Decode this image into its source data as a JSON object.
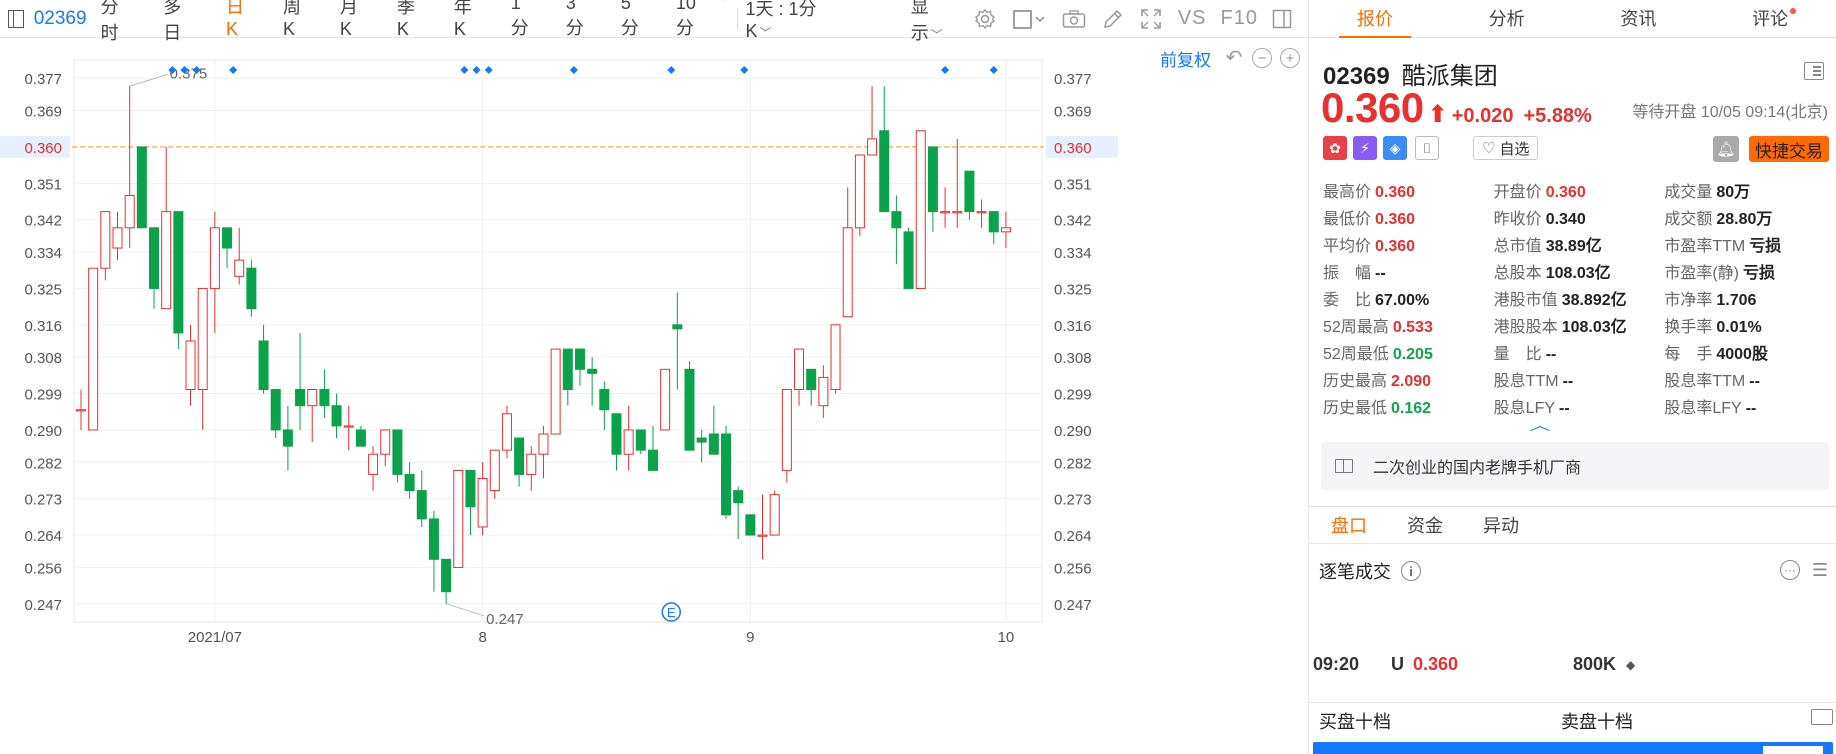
{
  "toolbar": {
    "code": "02369",
    "periods": [
      "分时",
      "多日",
      "日K",
      "周K",
      "月K",
      "季K",
      "年K",
      "1分",
      "3分",
      "5分",
      "10分"
    ],
    "active_period": "日K",
    "kline_mode": "1天 : 1分K",
    "display_label": "显示",
    "vs_label": "VS",
    "f10_label": "F10",
    "icons": [
      "sidebar-toggle-icon",
      "settings-icon",
      "rectangle-draw-icon",
      "camera-icon",
      "pen-icon",
      "fullscreen-icon",
      "panel-icon"
    ]
  },
  "chart": {
    "adjust_label": "前复权",
    "controls": [
      "undo-icon",
      "zoom-out-icon",
      "zoom-in-icon"
    ]
  },
  "chart_data": {
    "type": "candlestick",
    "y_ticks": [
      "0.377",
      "0.369",
      "0.360",
      "0.351",
      "0.342",
      "0.334",
      "0.325",
      "0.316",
      "0.308",
      "0.299",
      "0.290",
      "0.282",
      "0.273",
      "0.264",
      "0.256",
      "0.247"
    ],
    "ylim": [
      0.2425,
      0.3815
    ],
    "x_labels": [
      "2021/07",
      "8",
      "9",
      "10"
    ],
    "x_label_index": [
      11,
      33,
      55,
      76
    ],
    "current_price": "0.360",
    "max_marker": "0.375",
    "min_marker": "0.247",
    "event_marker": "E",
    "event_index": 48.5,
    "diamond_index": [
      7.5,
      8.5,
      9.5,
      12.5,
      31.5,
      32.5,
      33.5,
      40.5,
      48.5,
      54.5,
      71,
      75
    ],
    "colors": {
      "up": "#e93030",
      "down": "#0aa24a",
      "current_line": "#ff9a4a",
      "marker": "#1677ff"
    },
    "candles": [
      [
        0.295,
        0.3,
        0.29,
        0.295
      ],
      [
        0.29,
        0.33,
        0.29,
        0.33
      ],
      [
        0.33,
        0.344,
        0.327,
        0.344
      ],
      [
        0.335,
        0.344,
        0.332,
        0.34
      ],
      [
        0.34,
        0.375,
        0.335,
        0.348
      ],
      [
        0.36,
        0.36,
        0.34,
        0.34
      ],
      [
        0.34,
        0.34,
        0.32,
        0.325
      ],
      [
        0.32,
        0.36,
        0.32,
        0.344
      ],
      [
        0.344,
        0.344,
        0.31,
        0.314
      ],
      [
        0.3,
        0.316,
        0.296,
        0.312
      ],
      [
        0.3,
        0.325,
        0.29,
        0.325
      ],
      [
        0.325,
        0.344,
        0.314,
        0.34
      ],
      [
        0.34,
        0.34,
        0.33,
        0.335
      ],
      [
        0.328,
        0.34,
        0.326,
        0.332
      ],
      [
        0.33,
        0.332,
        0.318,
        0.32
      ],
      [
        0.312,
        0.316,
        0.299,
        0.3
      ],
      [
        0.3,
        0.3,
        0.288,
        0.29
      ],
      [
        0.29,
        0.296,
        0.28,
        0.286
      ],
      [
        0.3,
        0.314,
        0.29,
        0.296
      ],
      [
        0.296,
        0.3,
        0.287,
        0.3
      ],
      [
        0.3,
        0.305,
        0.293,
        0.296
      ],
      [
        0.296,
        0.299,
        0.288,
        0.291
      ],
      [
        0.291,
        0.296,
        0.285,
        0.291
      ],
      [
        0.29,
        0.291,
        0.286,
        0.286
      ],
      [
        0.279,
        0.286,
        0.275,
        0.284
      ],
      [
        0.284,
        0.29,
        0.281,
        0.29
      ],
      [
        0.29,
        0.29,
        0.277,
        0.279
      ],
      [
        0.279,
        0.282,
        0.273,
        0.275
      ],
      [
        0.275,
        0.28,
        0.266,
        0.268
      ],
      [
        0.268,
        0.27,
        0.25,
        0.258
      ],
      [
        0.258,
        0.258,
        0.247,
        0.25
      ],
      [
        0.256,
        0.28,
        0.256,
        0.28
      ],
      [
        0.28,
        0.28,
        0.264,
        0.271
      ],
      [
        0.266,
        0.282,
        0.264,
        0.278
      ],
      [
        0.275,
        0.285,
        0.273,
        0.285
      ],
      [
        0.285,
        0.296,
        0.283,
        0.294
      ],
      [
        0.288,
        0.288,
        0.276,
        0.279
      ],
      [
        0.279,
        0.286,
        0.275,
        0.284
      ],
      [
        0.284,
        0.291,
        0.278,
        0.289
      ],
      [
        0.289,
        0.31,
        0.289,
        0.31
      ],
      [
        0.31,
        0.31,
        0.296,
        0.3
      ],
      [
        0.31,
        0.31,
        0.301,
        0.305
      ],
      [
        0.305,
        0.308,
        0.296,
        0.304
      ],
      [
        0.3,
        0.302,
        0.29,
        0.295
      ],
      [
        0.294,
        0.294,
        0.28,
        0.284
      ],
      [
        0.284,
        0.296,
        0.28,
        0.29
      ],
      [
        0.29,
        0.29,
        0.284,
        0.285
      ],
      [
        0.285,
        0.291,
        0.28,
        0.28
      ],
      [
        0.29,
        0.305,
        0.29,
        0.305
      ],
      [
        0.316,
        0.324,
        0.3,
        0.315
      ],
      [
        0.305,
        0.307,
        0.285,
        0.285
      ],
      [
        0.288,
        0.29,
        0.282,
        0.287
      ],
      [
        0.289,
        0.296,
        0.284,
        0.284
      ],
      [
        0.289,
        0.291,
        0.268,
        0.269
      ],
      [
        0.275,
        0.276,
        0.263,
        0.272
      ],
      [
        0.269,
        0.269,
        0.264,
        0.264
      ],
      [
        0.264,
        0.274,
        0.258,
        0.264
      ],
      [
        0.264,
        0.275,
        0.264,
        0.274
      ],
      [
        0.28,
        0.3,
        0.277,
        0.3
      ],
      [
        0.3,
        0.31,
        0.296,
        0.31
      ],
      [
        0.305,
        0.305,
        0.296,
        0.3
      ],
      [
        0.296,
        0.306,
        0.293,
        0.303
      ],
      [
        0.3,
        0.316,
        0.299,
        0.316
      ],
      [
        0.318,
        0.35,
        0.318,
        0.34
      ],
      [
        0.34,
        0.355,
        0.338,
        0.358
      ],
      [
        0.358,
        0.375,
        0.358,
        0.362
      ],
      [
        0.364,
        0.375,
        0.344,
        0.344
      ],
      [
        0.344,
        0.348,
        0.331,
        0.34
      ],
      [
        0.339,
        0.34,
        0.325,
        0.325
      ],
      [
        0.325,
        0.364,
        0.325,
        0.364
      ],
      [
        0.36,
        0.36,
        0.339,
        0.344
      ],
      [
        0.344,
        0.35,
        0.34,
        0.344
      ],
      [
        0.344,
        0.362,
        0.34,
        0.344
      ],
      [
        0.354,
        0.354,
        0.342,
        0.344
      ],
      [
        0.344,
        0.347,
        0.34,
        0.344
      ],
      [
        0.344,
        0.344,
        0.336,
        0.339
      ],
      [
        0.339,
        0.344,
        0.335,
        0.34
      ]
    ]
  },
  "panel": {
    "tabs": [
      "报价",
      "分析",
      "资讯",
      "评论"
    ],
    "active_tab": "报价",
    "code": "02369",
    "name": "酷派集团",
    "price": "0.360",
    "arrow": "⬆",
    "change": "+0.020",
    "change_pct": "+5.88%",
    "trade_status": "等待开盘 10/05 09:14(北京)",
    "watch_label": "自选",
    "trade_label": "快捷交易",
    "stats": [
      [
        {
          "label": "最高价",
          "value": "0.360",
          "color": "red"
        },
        {
          "label": "开盘价",
          "value": "0.360",
          "color": "red"
        },
        {
          "label": "成交量",
          "value": "80万",
          "color": ""
        }
      ],
      [
        {
          "label": "最低价",
          "value": "0.360",
          "color": "red"
        },
        {
          "label": "昨收价",
          "value": "0.340",
          "color": ""
        },
        {
          "label": "成交额",
          "value": "28.80万",
          "color": ""
        }
      ],
      [
        {
          "label": "平均价",
          "value": "0.360",
          "color": "red"
        },
        {
          "label": "总市值",
          "value": "38.89亿",
          "color": ""
        },
        {
          "label": "市盈率TTM",
          "value": "亏损",
          "color": ""
        }
      ],
      [
        {
          "label": "振　幅",
          "value": "--",
          "color": ""
        },
        {
          "label": "总股本",
          "value": "108.03亿",
          "color": ""
        },
        {
          "label": "市盈率(静)",
          "value": "亏损",
          "color": ""
        }
      ],
      [
        {
          "label": "委　比",
          "value": "67.00%",
          "color": ""
        },
        {
          "label": "港股市值",
          "value": "38.892亿",
          "color": ""
        },
        {
          "label": "市净率",
          "value": "1.706",
          "color": ""
        }
      ],
      [
        {
          "label": "52周最高",
          "value": "0.533",
          "color": "red"
        },
        {
          "label": "港股股本",
          "value": "108.03亿",
          "color": ""
        },
        {
          "label": "换手率",
          "value": "0.01%",
          "color": ""
        }
      ],
      [
        {
          "label": "52周最低",
          "value": "0.205",
          "color": "green"
        },
        {
          "label": "量　比",
          "value": "--",
          "color": ""
        },
        {
          "label": "每　手",
          "value": "4000股",
          "color": ""
        }
      ],
      [
        {
          "label": "历史最高",
          "value": "2.090",
          "color": "red"
        },
        {
          "label": "股息TTM",
          "value": "--",
          "color": ""
        },
        {
          "label": "股息率TTM",
          "value": "--",
          "color": ""
        }
      ],
      [
        {
          "label": "历史最低",
          "value": "0.162",
          "color": "green"
        },
        {
          "label": "股息LFY",
          "value": "--",
          "color": ""
        },
        {
          "label": "股息率LFY",
          "value": "--",
          "color": ""
        }
      ]
    ],
    "description": "二次创业的国内老牌手机厂商",
    "tabs2": [
      "盘口",
      "资金",
      "异动"
    ],
    "active_tab2": "盘口",
    "ticks_title": "逐笔成交",
    "tick": {
      "time": "09:20",
      "dir": "U",
      "price": "0.360",
      "volume": "800K"
    },
    "buy_book": "买盘十档",
    "sell_book": "卖盘十档",
    "colors": {
      "accent": "#ff6a00",
      "up": "#e93030",
      "down": "#12a34a",
      "link": "#1677ff"
    }
  }
}
